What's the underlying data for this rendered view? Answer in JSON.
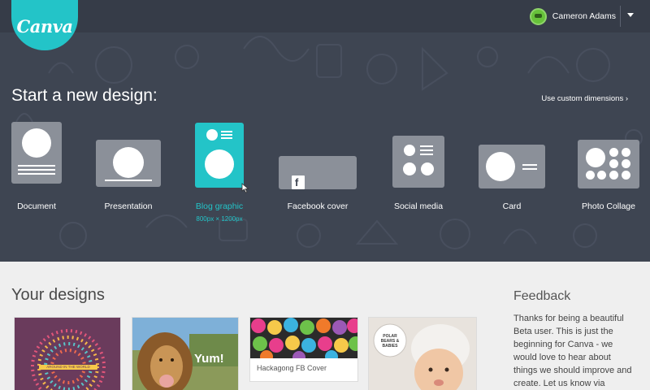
{
  "brand": {
    "logo_text": "Canva",
    "accent": "#23c4c8"
  },
  "user": {
    "name": "Cameron Adams",
    "avatar_icon": "avatar-icon",
    "menu_icon": "caret-down-icon"
  },
  "start": {
    "title": "Start a new design:",
    "custom_link": "Use custom dimensions ›",
    "types": [
      {
        "label": "Document",
        "icon": "document-icon"
      },
      {
        "label": "Presentation",
        "icon": "presentation-icon"
      },
      {
        "label": "Blog graphic",
        "icon": "blog-graphic-icon",
        "selected": true,
        "dimensions": "800px × 1200px"
      },
      {
        "label": "Facebook cover",
        "icon": "facebook-cover-icon"
      },
      {
        "label": "Social media",
        "icon": "social-media-icon"
      },
      {
        "label": "Card",
        "icon": "card-icon"
      },
      {
        "label": "Photo Collage",
        "icon": "photo-collage-icon"
      }
    ]
  },
  "designs": {
    "title": "Your designs",
    "items": [
      {
        "title": "",
        "text": "AROUND IN THE WORLD"
      },
      {
        "title": "",
        "text": "Yum!"
      },
      {
        "title": "Hackagong FB Cover",
        "text": ""
      },
      {
        "title": "",
        "text": "POLAR BEARS & BABIES"
      }
    ]
  },
  "feedback": {
    "title": "Feedback",
    "text": "Thanks for being a beautiful Beta user. This is just the beginning for Canva - we would love to hear about things we should improve and create. Let us know via"
  }
}
